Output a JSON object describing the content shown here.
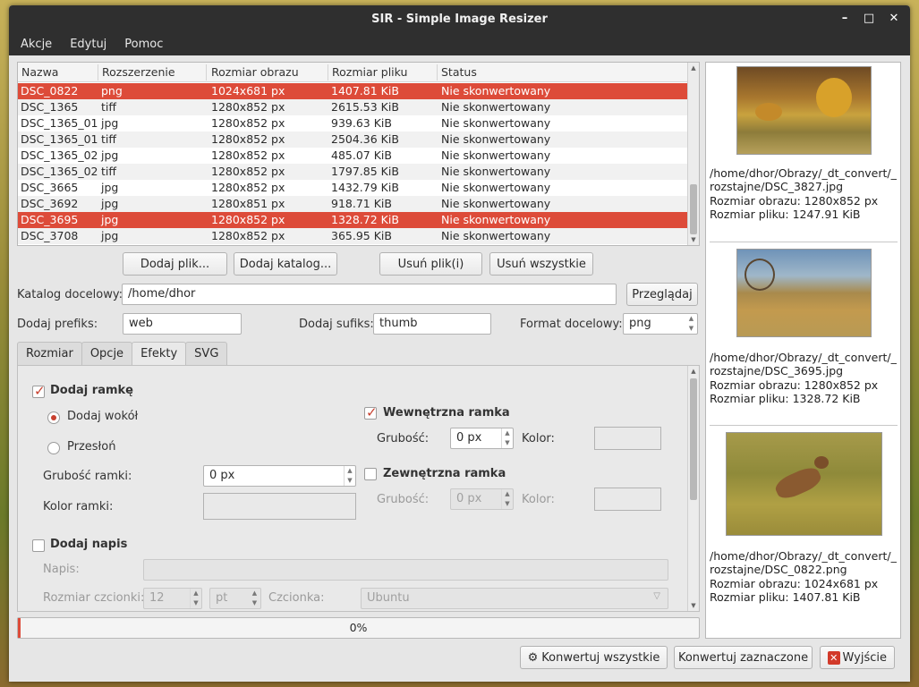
{
  "window": {
    "title": "SIR - Simple Image Resizer"
  },
  "menu": [
    "Akcje",
    "Edytuj",
    "Pomoc"
  ],
  "file_table": {
    "columns": [
      "Nazwa",
      "Rozszerzenie",
      "Rozmiar obrazu",
      "Rozmiar pliku",
      "Status"
    ],
    "rows": [
      {
        "name": "DSC_0822",
        "ext": "png",
        "img_size": "1024x681 px",
        "file_size": "1407.81 KiB",
        "status": "Nie skonwertowany",
        "selected": true
      },
      {
        "name": "DSC_1365",
        "ext": "tiff",
        "img_size": "1280x852 px",
        "file_size": "2615.53 KiB",
        "status": "Nie skonwertowany",
        "selected": false
      },
      {
        "name": "DSC_1365_01",
        "ext": "jpg",
        "img_size": "1280x852 px",
        "file_size": "939.63 KiB",
        "status": "Nie skonwertowany",
        "selected": false
      },
      {
        "name": "DSC_1365_01",
        "ext": "tiff",
        "img_size": "1280x852 px",
        "file_size": "2504.36 KiB",
        "status": "Nie skonwertowany",
        "selected": false
      },
      {
        "name": "DSC_1365_02",
        "ext": "jpg",
        "img_size": "1280x852 px",
        "file_size": "485.07 KiB",
        "status": "Nie skonwertowany",
        "selected": false
      },
      {
        "name": "DSC_1365_02",
        "ext": "tiff",
        "img_size": "1280x852 px",
        "file_size": "1797.85 KiB",
        "status": "Nie skonwertowany",
        "selected": false
      },
      {
        "name": "DSC_3665",
        "ext": "jpg",
        "img_size": "1280x852 px",
        "file_size": "1432.79 KiB",
        "status": "Nie skonwertowany",
        "selected": false
      },
      {
        "name": "DSC_3692",
        "ext": "jpg",
        "img_size": "1280x851 px",
        "file_size": "918.71 KiB",
        "status": "Nie skonwertowany",
        "selected": false
      },
      {
        "name": "DSC_3695",
        "ext": "jpg",
        "img_size": "1280x852 px",
        "file_size": "1328.72 KiB",
        "status": "Nie skonwertowany",
        "selected": true
      },
      {
        "name": "DSC_3708",
        "ext": "jpg",
        "img_size": "1280x852 px",
        "file_size": "365.95 KiB",
        "status": "Nie skonwertowany",
        "selected": false
      }
    ]
  },
  "file_buttons": {
    "add_file": "Dodaj plik...",
    "add_dir": "Dodaj katalog...",
    "remove_files": "Usuń plik(i)",
    "remove_all": "Usuń wszystkie"
  },
  "target": {
    "dir_label": "Katalog docelowy:",
    "dir_value": "/home/dhor",
    "browse": "Przeglądaj",
    "prefix_label": "Dodaj prefiks:",
    "prefix_value": "web",
    "suffix_label": "Dodaj sufiks:",
    "suffix_value": "thumb",
    "format_label": "Format docelowy:",
    "format_value": "png"
  },
  "tabs": [
    "Rozmiar",
    "Opcje",
    "Efekty",
    "SVG"
  ],
  "active_tab": "Efekty",
  "effects": {
    "add_border": "Dodaj ramkę",
    "add_border_checked": true,
    "around": "Dodaj wokół",
    "overlay": "Przesłoń",
    "border_width_label": "Grubość ramki:",
    "border_width_value": "0 px",
    "border_color_label": "Kolor ramki:",
    "inner_border": "Wewnętrzna ramka",
    "inner_border_checked": true,
    "inner_width_label": "Grubość:",
    "inner_width_value": "0 px",
    "inner_color_label": "Kolor:",
    "outer_border": "Zewnętrzna ramka",
    "outer_border_checked": false,
    "outer_width_label": "Grubość:",
    "outer_width_value": "0 px",
    "outer_color_label": "Kolor:",
    "add_text": "Dodaj napis",
    "add_text_checked": false,
    "text_label": "Napis:",
    "text_value": "",
    "font_size_label": "Rozmiar czcionki:",
    "font_size_value": "12",
    "font_unit_value": "pt",
    "font_label": "Czcionka:",
    "font_value": "Ubuntu"
  },
  "progress": {
    "text": "0%",
    "fraction": 0.0
  },
  "actions": {
    "convert_all": "Konwertuj wszystkie",
    "convert_selected": "Konwertuj zaznaczone",
    "exit": "Wyjście"
  },
  "previews": [
    {
      "path": "/home/dhor/Obrazy/_dt_convert/_rozstajne/DSC_3827.jpg",
      "img_size": "Rozmiar obrazu: 1280x852 px",
      "file_size": "Rozmiar pliku: 1247.91 KiB"
    },
    {
      "path": "/home/dhor/Obrazy/_dt_convert/_rozstajne/DSC_3695.jpg",
      "img_size": "Rozmiar obrazu: 1280x852 px",
      "file_size": "Rozmiar pliku: 1328.72 KiB"
    },
    {
      "path": "/home/dhor/Obrazy/_dt_convert/_rozstajne/DSC_0822.png",
      "img_size": "Rozmiar obrazu: 1024x681 px",
      "file_size": "Rozmiar pliku: 1407.81 KiB"
    }
  ],
  "colors": {
    "accent": "#dd4b39",
    "titlebar": "#2f2f2f"
  }
}
